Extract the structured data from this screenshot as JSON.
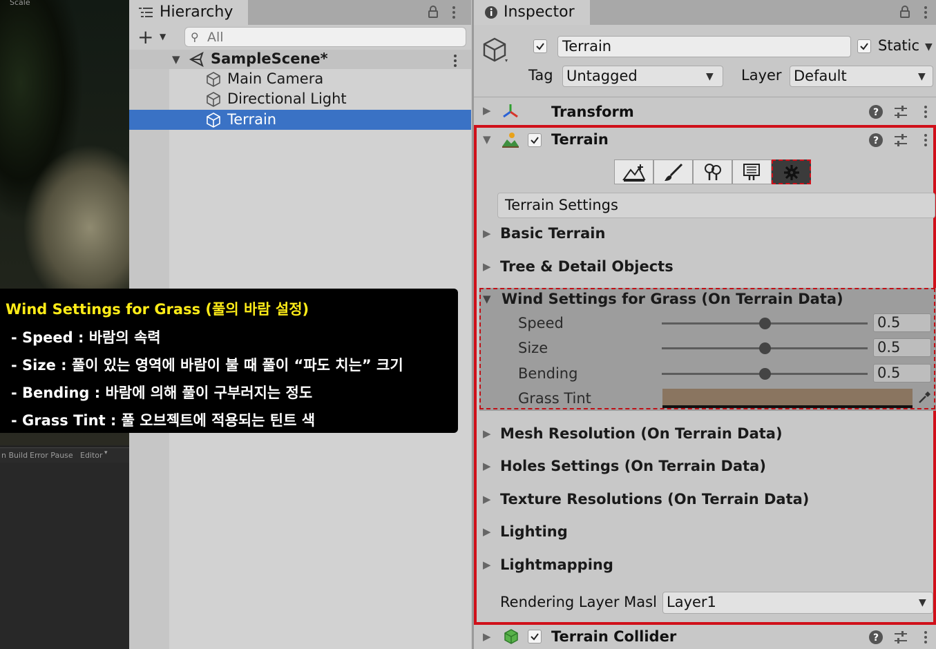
{
  "scene_panel": {
    "scale_label": "Scale",
    "console_buttons": [
      "n Build",
      "Error Pause",
      "Editor"
    ]
  },
  "hierarchy": {
    "tab_title": "Hierarchy",
    "add_label": "+",
    "search_placeholder": "All",
    "scene_name": "SampleScene*",
    "items": [
      {
        "name": "Main Camera",
        "selected": false
      },
      {
        "name": "Directional Light",
        "selected": false
      },
      {
        "name": "Terrain",
        "selected": true
      }
    ]
  },
  "inspector": {
    "tab_title": "Inspector",
    "object": {
      "name": "Terrain",
      "active": true,
      "static_label": "Static",
      "static": true,
      "tag_label": "Tag",
      "tag_value": "Untagged",
      "layer_label": "Layer",
      "layer_value": "Default"
    },
    "components": {
      "transform": "Transform",
      "terrain": "Terrain",
      "terrain_collider": "Terrain Collider"
    },
    "terrain_tools": [
      "raise-lower",
      "paint",
      "trees",
      "details",
      "settings"
    ],
    "settings_header": "Terrain Settings",
    "sections": {
      "basic": "Basic Terrain",
      "tree_detail": "Tree & Detail Objects",
      "wind": "Wind Settings for Grass (On Terrain Data)",
      "mesh": "Mesh Resolution (On Terrain Data)",
      "holes": "Holes Settings (On Terrain Data)",
      "texture": "Texture Resolutions (On Terrain Data)",
      "lighting": "Lighting",
      "lightmapping": "Lightmapping"
    },
    "wind": {
      "speed_label": "Speed",
      "speed": 0.5,
      "speed_text": "0.5",
      "size_label": "Size",
      "size": 0.5,
      "size_text": "0.5",
      "bending_label": "Bending",
      "bending": 0.5,
      "bending_text": "0.5",
      "tint_label": "Grass Tint",
      "tint_color": "#8a7560"
    },
    "rendering_layer_label": "Rendering Layer Masl",
    "rendering_layer_value": "Layer1"
  },
  "annotation": {
    "title": "Wind Settings for Grass (풀의 바람 설정)",
    "lines": [
      "- Speed : 바람의 속력",
      "- Size : 풀이 있는 영역에 바람이 불 때 풀이 “파도 치는” 크기",
      "- Bending : 바람에 의해 풀이 구부러지는 정도",
      "- Grass Tint : 풀 오브젝트에 적용되는 틴트 색"
    ]
  },
  "colors": {
    "highlight_red": "#d0101a",
    "selection_blue": "#3a72c5",
    "annotation_title": "#ffec18"
  }
}
